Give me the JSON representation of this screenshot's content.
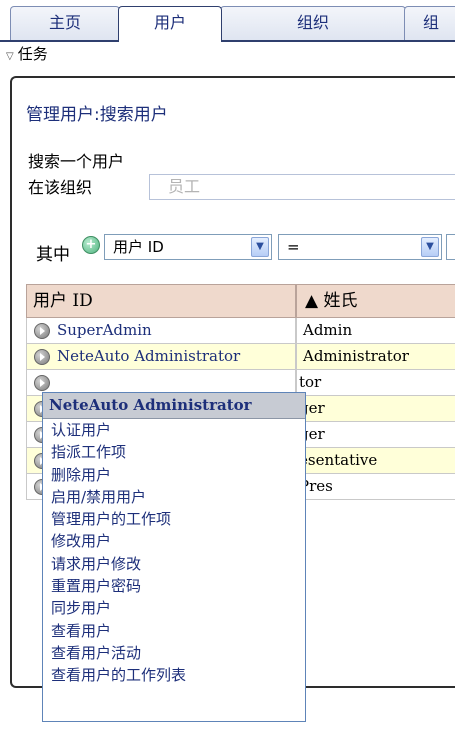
{
  "tabs": [
    "主页",
    "用户",
    "组织",
    "组"
  ],
  "task_header": "任务",
  "panel": {
    "title": "管理用户:搜索用户",
    "search_label": "搜索一个用户",
    "org_label": "在该组织",
    "org_value": "员工",
    "where_label": "其中",
    "field_select": "用户 ID",
    "operator_select": "=",
    "value_select": "*"
  },
  "table": {
    "headers": [
      "用户 ID",
      "▲ 姓氏"
    ],
    "rows": [
      {
        "id": "SuperAdmin",
        "last": "Admin"
      },
      {
        "id": "NeteAuto Administrator",
        "last": "Administrator"
      },
      {
        "id": "",
        "last": "tor"
      },
      {
        "id": "",
        "last": "ger"
      },
      {
        "id": "",
        "last": "ger"
      },
      {
        "id": "",
        "last": "esentative"
      },
      {
        "id": "",
        "last": "Pres"
      }
    ]
  },
  "context_menu": {
    "title": "NeteAuto Administrator",
    "items": [
      "认证用户",
      "指派工作项",
      "删除用户",
      "启用/禁用用户",
      "管理用户的工作项",
      "修改用户",
      "请求用户修改",
      "重置用户密码",
      "同步用户",
      "查看用户",
      "查看用户活动",
      "查看用户的工作列表"
    ]
  },
  "colors": {
    "link": "#1d2f7a",
    "header_bg": "#efd9cc",
    "row_highlight": "#ffffd9",
    "menu_title_bg": "#c7cbd3"
  }
}
